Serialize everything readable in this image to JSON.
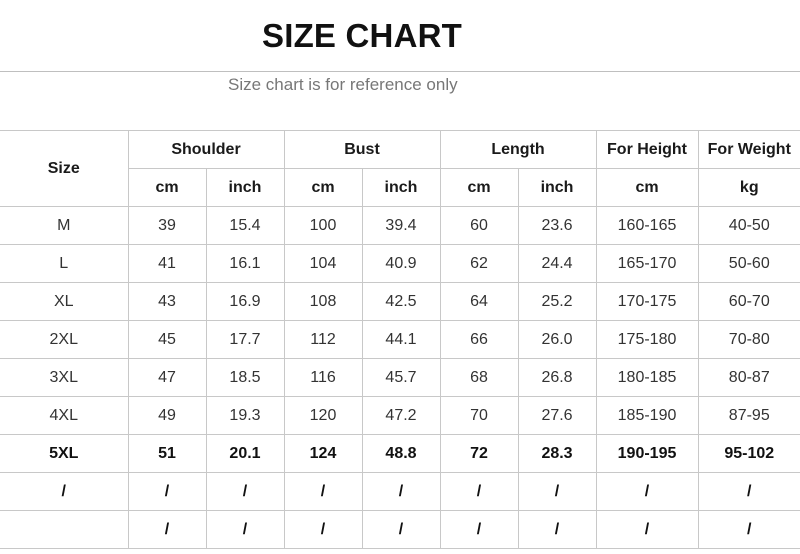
{
  "title": "SIZE CHART",
  "subtitle": "Size chart is for reference only",
  "table": {
    "size_header": "Size",
    "groups": [
      "Shoulder",
      "Bust",
      "Length",
      "For Height",
      "For Weight"
    ],
    "units": [
      "cm",
      "inch",
      "cm",
      "inch",
      "cm",
      "inch",
      "cm",
      "kg"
    ],
    "rows": [
      [
        "M",
        "39",
        "15.4",
        "100",
        "39.4",
        "60",
        "23.6",
        "160-165",
        "40-50"
      ],
      [
        "L",
        "41",
        "16.1",
        "104",
        "40.9",
        "62",
        "24.4",
        "165-170",
        "50-60"
      ],
      [
        "XL",
        "43",
        "16.9",
        "108",
        "42.5",
        "64",
        "25.2",
        "170-175",
        "60-70"
      ],
      [
        "2XL",
        "45",
        "17.7",
        "112",
        "44.1",
        "66",
        "26.0",
        "175-180",
        "70-80"
      ],
      [
        "3XL",
        "47",
        "18.5",
        "116",
        "45.7",
        "68",
        "26.8",
        "180-185",
        "80-87"
      ],
      [
        "4XL",
        "49",
        "19.3",
        "120",
        "47.2",
        "70",
        "27.6",
        "185-190",
        "87-95"
      ],
      [
        "5XL",
        "51",
        "20.1",
        "124",
        "48.8",
        "72",
        "28.3",
        "190-195",
        "95-102"
      ],
      [
        "/",
        "/",
        "/",
        "/",
        "/",
        "/",
        "/",
        "/",
        "/"
      ],
      [
        "",
        "/",
        "/",
        "/",
        "/",
        "/",
        "/",
        "/",
        "/"
      ]
    ]
  }
}
